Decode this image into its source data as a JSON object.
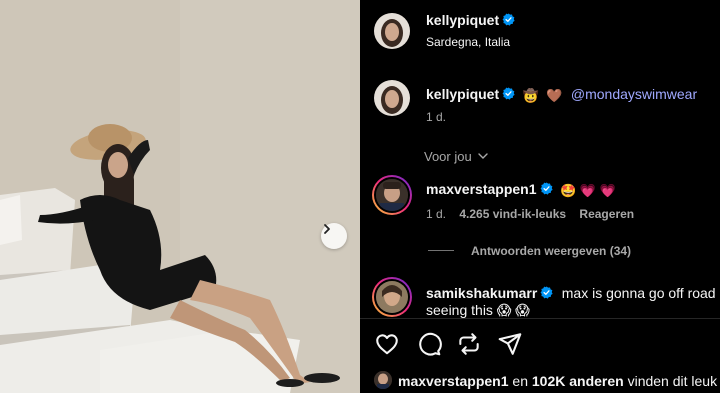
{
  "post": {
    "author": "kellypiquet",
    "location": "Sardegna, Italia"
  },
  "caption": {
    "author": "kellypiquet",
    "emoji_1": "🤠",
    "emoji_2": "🤎",
    "mention": "@mondayswimwear",
    "age": "1 d."
  },
  "filter": {
    "label": "Voor jou"
  },
  "comments": [
    {
      "author": "maxverstappen1",
      "text_emojis": "🤩 💗 💗",
      "age": "1 d.",
      "likes": "4.265 vind-ik-leuks",
      "reply_label": "Reageren",
      "view_replies": "Antwoorden weergeven (34)"
    },
    {
      "author": "samikshakumarr",
      "text_line1": "max is gonna go off road",
      "text_line2": "seeing this 😱 😱"
    }
  ],
  "likes_summary": {
    "user": "maxverstappen1",
    "middle": " en ",
    "count": "102K anderen",
    "suffix": " vinden dit leuk"
  },
  "icons": {
    "verified": "verified-badge-icon",
    "heart": "heart-icon",
    "comment": "comment-icon",
    "repost": "repost-icon",
    "share": "share-icon",
    "next": "chevron-right-icon"
  },
  "colors": {
    "verified": "#0095f6",
    "link": "#a0a9ff",
    "muted": "#a8a8a8"
  }
}
